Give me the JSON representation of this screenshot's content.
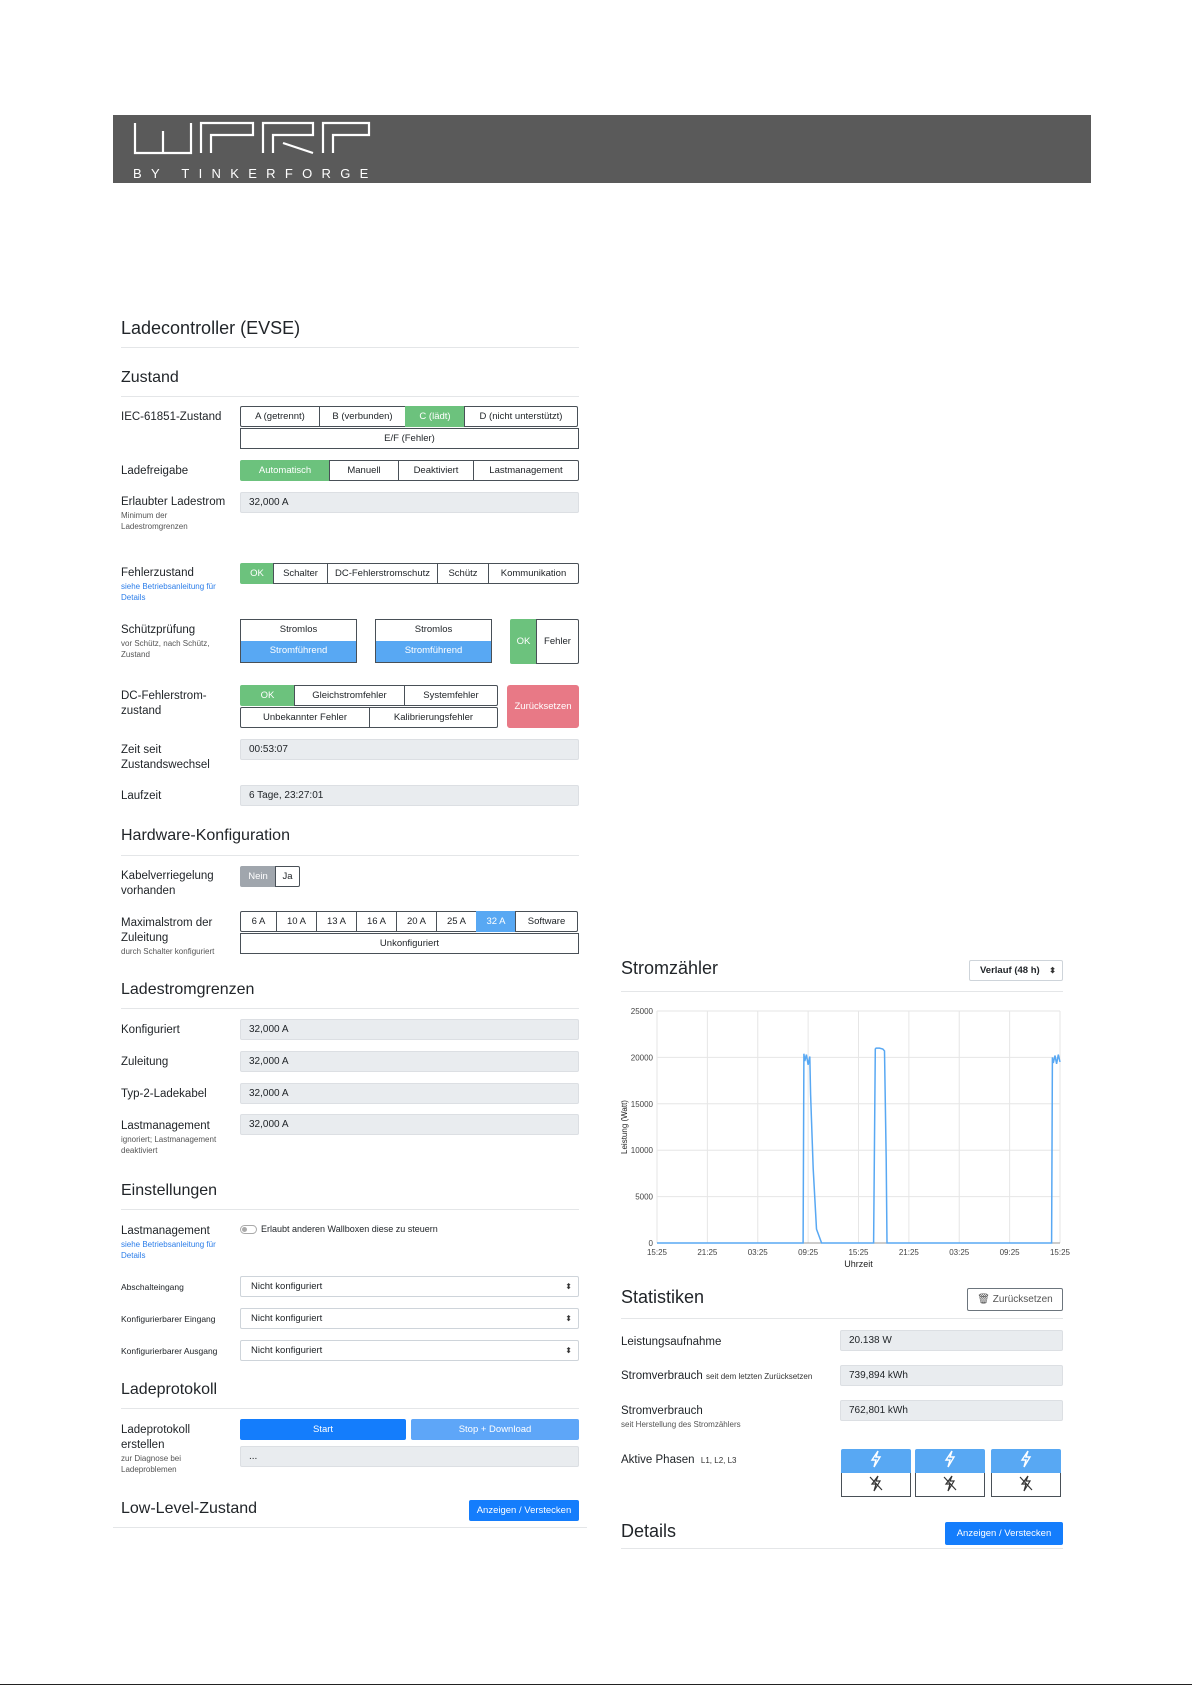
{
  "brand": {
    "logo_sub": "BY TINKERFORGE"
  },
  "evse": {
    "title": "Ladecontroller (EVSE)",
    "zustand": {
      "heading": "Zustand",
      "iec": {
        "label": "IEC-61851-Zustand",
        "options": [
          "A (getrennt)",
          "B (verbunden)",
          "C (lädt)",
          "D (nicht unterstützt)"
        ],
        "extra": "E/F (Fehler)",
        "selected": "C (lädt)"
      },
      "ladefreigabe": {
        "label": "Ladefreigabe",
        "options": [
          "Automatisch",
          "Manuell",
          "Deaktiviert",
          "Lastmanagement"
        ],
        "selected": "Automatisch"
      },
      "erlaubt": {
        "label": "Erlaubter Ladestrom",
        "sub": "Minimum der Ladestromgrenzen",
        "value": "32,000 A"
      },
      "fehler": {
        "label": "Fehlerzustand",
        "sub": "siehe Betriebsanleitung für Details",
        "options": [
          "OK",
          "Schalter",
          "DC-Fehlerstromschutz",
          "Schütz",
          "Kommunikation"
        ],
        "selected": "OK"
      },
      "schutz": {
        "label": "Schützprüfung",
        "sub": "vor Schütz, nach Schütz, Zustand",
        "a_top": "Stromlos",
        "a_bot": "Stromführend",
        "b_top": "Stromlos",
        "b_bot": "Stromführend",
        "ok": "OK",
        "err": "Fehler"
      },
      "dc": {
        "label": "DC-Fehlerstrom-zustand",
        "row1": [
          "OK",
          "Gleichstromfehler",
          "Systemfehler"
        ],
        "row2": [
          "Unbekannter Fehler",
          "Kalibrierungsfehler"
        ],
        "reset": "Zurücksetzen"
      },
      "zeit": {
        "label": "Zeit seit Zustandswechsel",
        "value": "00:53:07"
      },
      "laufzeit": {
        "label": "Laufzeit",
        "value": "6 Tage, 23:27:01"
      }
    },
    "hardware": {
      "heading": "Hardware-Konfiguration",
      "kabel": {
        "label": "Kabelverriegelung vorhanden",
        "options": [
          "Nein",
          "Ja"
        ],
        "selected": "Nein"
      },
      "max": {
        "label": "Maximalstrom der Zuleitung",
        "sub": "durch Schalter konfiguriert",
        "options": [
          "6 A",
          "10 A",
          "13 A",
          "16 A",
          "20 A",
          "25 A",
          "32 A",
          "Software"
        ],
        "extra": "Unkonfiguriert",
        "selected": "32 A"
      }
    },
    "grenzen": {
      "heading": "Ladestromgrenzen",
      "rows": [
        {
          "label": "Konfiguriert",
          "value": "32,000 A"
        },
        {
          "label": "Zuleitung",
          "value": "32,000 A"
        },
        {
          "label": "Typ-2-Ladekabel",
          "value": "32,000 A"
        },
        {
          "label": "Lastmanagement",
          "value": "32,000 A",
          "sub": "ignoriert; Lastmanagement deaktiviert"
        }
      ]
    },
    "einstellungen": {
      "heading": "Einstellungen",
      "lm": {
        "label": "Lastmanagement",
        "sub": "siehe Betriebsanleitung für Details",
        "switch_text": "Erlaubt anderen Wallboxen diese zu steuern"
      },
      "selects": [
        {
          "label": "Abschalteingang",
          "value": "Nicht konfiguriert"
        },
        {
          "label": "Konfigurierbarer Eingang",
          "value": "Nicht konfiguriert"
        },
        {
          "label": "Konfigurierbarer Ausgang",
          "value": "Nicht konfiguriert"
        }
      ]
    },
    "protokoll": {
      "heading": "Ladeprotokoll",
      "label": "Ladeprotokoll erstellen",
      "sub": "zur Diagnose bei Ladeproblemen",
      "start": "Start",
      "stop": "Stop + Download",
      "output": "..."
    },
    "lowlevel": {
      "heading": "Low-Level-Zustand",
      "button": "Anzeigen / Verstecken"
    }
  },
  "meter": {
    "title": "Stromzähler",
    "range_select": "Verlauf (48 h)",
    "stats": {
      "heading": "Statistiken",
      "reset": "Zurücksetzen",
      "leistung": {
        "label": "Leistungsaufnahme",
        "value": "20.138 W"
      },
      "verbrauch1": {
        "label": "Stromverbrauch",
        "inline_sub": "seit dem letzten Zurücksetzen",
        "value": "739,894 kWh"
      },
      "verbrauch2": {
        "label": "Stromverbrauch",
        "sub": "seit Herstellung des Stromzählers",
        "value": "762,801 kWh"
      },
      "phasen": {
        "label": "Aktive Phasen",
        "inline_sub": "L1, L2, L3"
      }
    },
    "details": {
      "heading": "Details",
      "button": "Anzeigen / Verstecken"
    }
  },
  "chart_data": {
    "type": "line",
    "xlabel": "Uhrzeit",
    "ylabel": "Leistung (Watt)",
    "ylim": [
      0,
      25000
    ],
    "yticks": [
      0,
      5000,
      10000,
      15000,
      20000,
      25000
    ],
    "xticks": [
      "15:25",
      "21:25",
      "03:25",
      "09:25",
      "15:25",
      "21:25",
      "03:25",
      "09:25",
      "15:25"
    ],
    "x_hours": [
      0,
      17.4,
      17.5,
      17.6,
      17.8,
      18.0,
      18.2,
      18.3,
      18.6,
      19.0,
      19.6,
      19.8,
      25.8,
      26.0,
      26.1,
      26.5,
      26.9,
      27.1,
      27.3,
      27.4,
      28.0,
      47.0,
      47.1,
      47.2,
      47.4,
      47.6,
      47.8,
      48.0
    ],
    "values": [
      0,
      0,
      20400,
      19600,
      20300,
      19200,
      20100,
      16000,
      8000,
      1500,
      0,
      0,
      0,
      20900,
      21000,
      21000,
      20900,
      20700,
      9000,
      0,
      0,
      0,
      20000,
      19400,
      20200,
      19300,
      20300,
      19500
    ],
    "color": "#58a8f3",
    "grid": true
  }
}
